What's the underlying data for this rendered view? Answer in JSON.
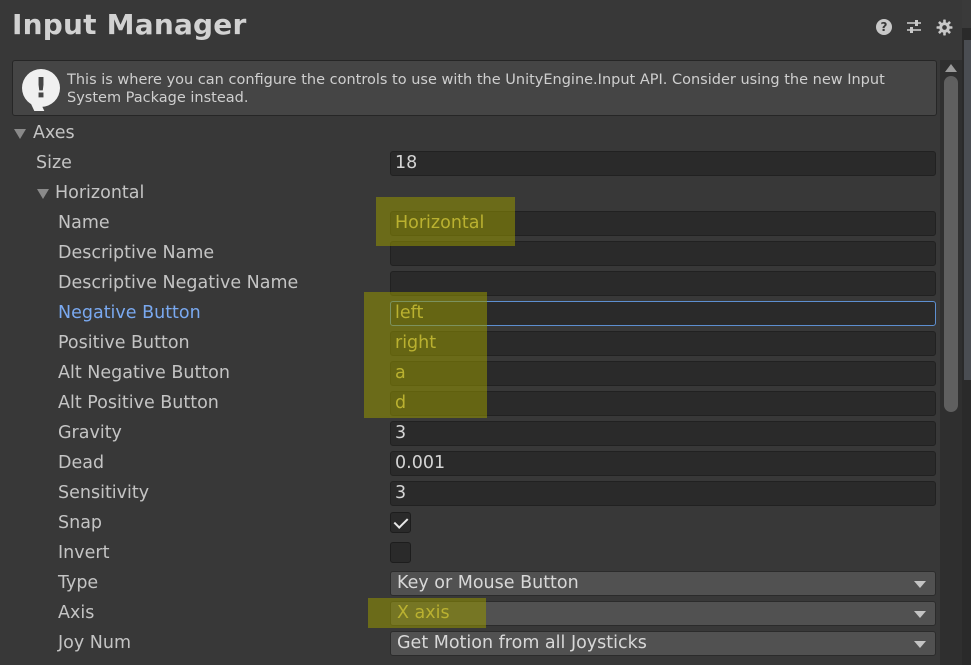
{
  "window": {
    "title": "Input Manager"
  },
  "header_icons": [
    "help-icon",
    "preset-sliders-icon",
    "settings-gear-icon"
  ],
  "info_box": {
    "icon": "warning-exclamation-icon",
    "text": "This is where you can configure the controls to use with the UnityEngine.Input API. Consider using the new Input System Package instead."
  },
  "axes": {
    "label": "Axes",
    "size_label": "Size",
    "size_value": "18",
    "horizontal": {
      "label": "Horizontal",
      "fields": {
        "name": {
          "label": "Name",
          "value": "Horizontal"
        },
        "descriptive_name": {
          "label": "Descriptive Name",
          "value": ""
        },
        "descriptive_negative_name": {
          "label": "Descriptive Negative Name",
          "value": ""
        },
        "negative_button": {
          "label": "Negative Button",
          "value": "left"
        },
        "positive_button": {
          "label": "Positive Button",
          "value": "right"
        },
        "alt_negative_button": {
          "label": "Alt Negative Button",
          "value": "a"
        },
        "alt_positive_button": {
          "label": "Alt Positive Button",
          "value": "d"
        },
        "gravity": {
          "label": "Gravity",
          "value": "3"
        },
        "dead": {
          "label": "Dead",
          "value": "0.001"
        },
        "sensitivity": {
          "label": "Sensitivity",
          "value": "3"
        },
        "snap": {
          "label": "Snap",
          "checked": true
        },
        "invert": {
          "label": "Invert",
          "checked": false
        },
        "type": {
          "label": "Type",
          "value": "Key or Mouse Button"
        },
        "axis": {
          "label": "Axis",
          "value": "X axis"
        },
        "joy_num": {
          "label": "Joy Num",
          "value": "Get Motion from all Joysticks"
        }
      }
    }
  },
  "colors": {
    "background": "#383838",
    "field_bg": "#2a2a2a",
    "active_label": "#7aa9f0",
    "highlight": "#969600",
    "highlight_text": "#e6d36a"
  }
}
